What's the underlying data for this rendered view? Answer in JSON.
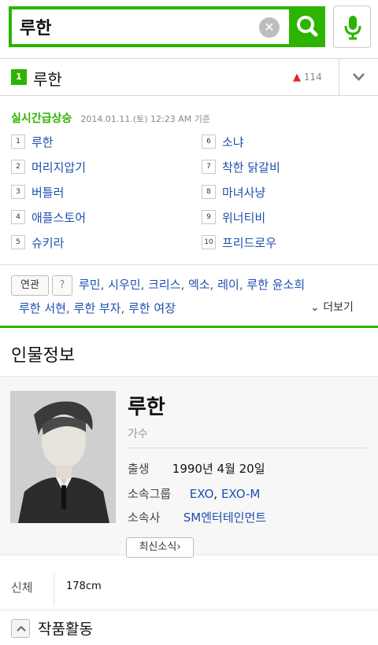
{
  "search": {
    "value": "루한",
    "placeholder": ""
  },
  "keyword_header": {
    "rank": "1",
    "title": "루한",
    "change_arrow": "▲",
    "change_value": "114"
  },
  "realtime": {
    "title": "실시간급상승",
    "timestamp": "2014.01.11.(토) 12:23 AM 기준",
    "items": [
      {
        "rank": "1",
        "label": "루한"
      },
      {
        "rank": "2",
        "label": "머리지압기"
      },
      {
        "rank": "3",
        "label": "버틀러"
      },
      {
        "rank": "4",
        "label": "애플스토어"
      },
      {
        "rank": "5",
        "label": "슈키라"
      },
      {
        "rank": "6",
        "label": "소냐"
      },
      {
        "rank": "7",
        "label": "착한 닭갈비"
      },
      {
        "rank": "8",
        "label": "마녀사냥"
      },
      {
        "rank": "9",
        "label": "위너티비"
      },
      {
        "rank": "10",
        "label": "프리드로우"
      }
    ]
  },
  "related": {
    "tag": "연관",
    "help": "?",
    "keywords_line1": [
      "루민",
      "시우민",
      "크리스",
      "엑소",
      "레이",
      "루한 윤소희"
    ],
    "keywords_line2": [
      "루한 서현",
      "루한 부자",
      "루한 여장"
    ],
    "more": "더보기"
  },
  "person": {
    "section_title": "인물정보",
    "name": "루한",
    "job": "가수",
    "birth_key": "출생",
    "birth_value": "1990년 4월 20일",
    "group_key": "소속그룹",
    "group_values": [
      "EXO",
      "EXO-M"
    ],
    "agency_key": "소속사",
    "agency_value": "SM엔터테인먼트",
    "news_button": "최신소식",
    "body_key": "신체",
    "body_value": "178cm",
    "works_title": "작품활동"
  },
  "colors": {
    "brand_green": "#2db400",
    "link_blue": "#1e4fb0",
    "up_red": "#e8222a"
  }
}
